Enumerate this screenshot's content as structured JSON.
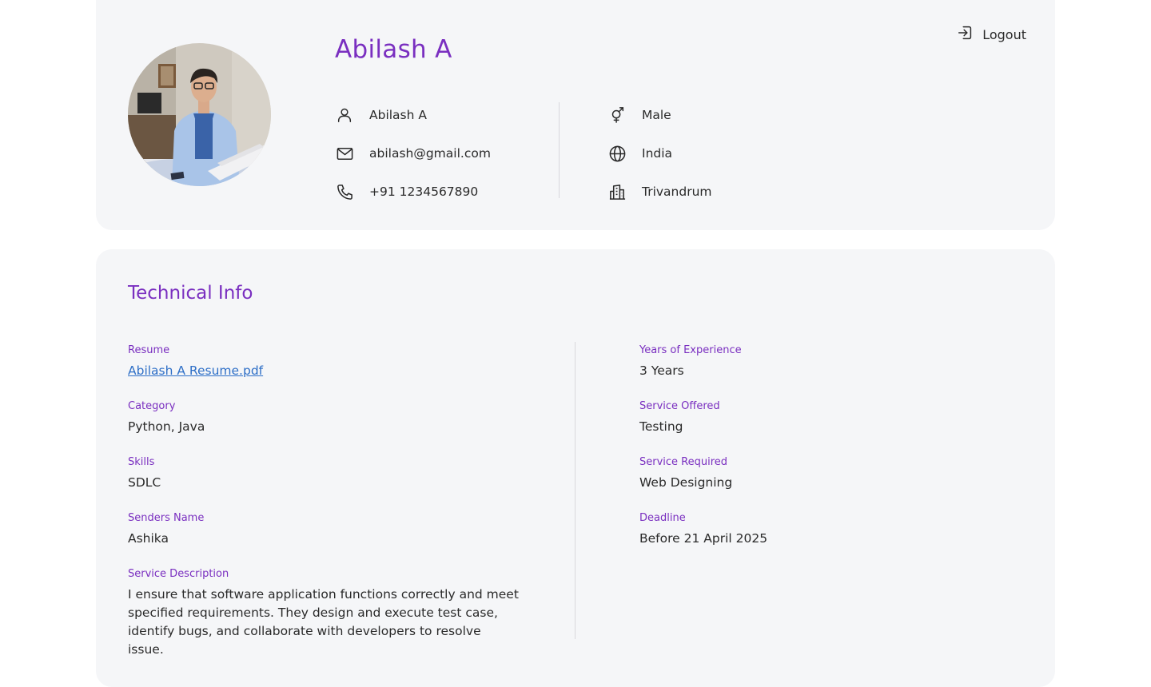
{
  "profile": {
    "name": "Abilash A",
    "logout_label": "Logout",
    "left_info": [
      {
        "icon": "user-icon",
        "text": "Abilash A"
      },
      {
        "icon": "mail-icon",
        "text": "abilash@gmail.com"
      },
      {
        "icon": "phone-icon",
        "text": "+91 1234567890"
      }
    ],
    "right_info": [
      {
        "icon": "gender-icon",
        "text": "Male"
      },
      {
        "icon": "globe-icon",
        "text": "India"
      },
      {
        "icon": "building-icon",
        "text": "Trivandrum"
      }
    ]
  },
  "technical": {
    "title": "Technical Info",
    "resume": {
      "label": "Resume",
      "value": "Abilash A Resume.pdf"
    },
    "category": {
      "label": "Category",
      "value": "Python, Java"
    },
    "skills": {
      "label": "Skills",
      "value": "SDLC"
    },
    "senders_name": {
      "label": "Senders Name",
      "value": "Ashika"
    },
    "service_description": {
      "label": "Service Description",
      "value": "I ensure that software application functions correctly and meet specified requirements. They design and execute test case, identify bugs, and collaborate with developers to resolve issue."
    },
    "experience": {
      "label": "Years of Experience",
      "value": "3 Years"
    },
    "service_offered": {
      "label": "Service Offered",
      "value": "Testing"
    },
    "service_required": {
      "label": "Service Required",
      "value": "Web Designing"
    },
    "deadline": {
      "label": "Deadline",
      "value": "Before 21 April 2025"
    }
  },
  "colors": {
    "accent": "#7a2fc0",
    "link": "#2e6fc7",
    "card_bg": "#f5f6f8"
  }
}
